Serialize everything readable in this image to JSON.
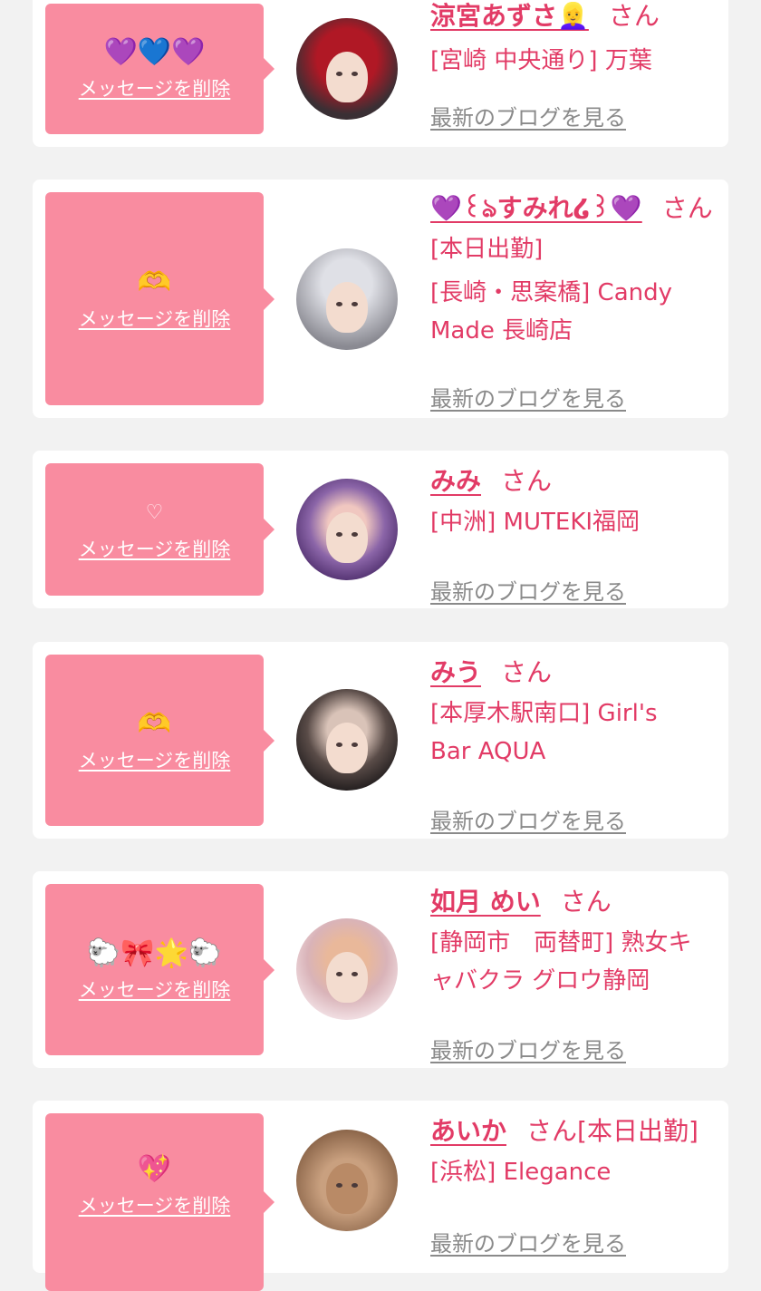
{
  "common": {
    "delete_label": "メッセージを削除",
    "blog_label": "最新のブログを見る",
    "san": "さん"
  },
  "items": [
    {
      "name": "涼宮あずさ👱‍♀️",
      "message": "💜💙💜",
      "suffix": "",
      "lines": [
        "[宮崎 中央通り] 万葉"
      ],
      "avatar_colors": [
        "#b01825",
        "#3a2f34"
      ]
    },
    {
      "name": "💜꒰ঌすみれ໒꒱💜",
      "message": "🫶",
      "suffix": "",
      "lines": [
        "[本日出勤]",
        "[長崎・思案橋] Candy",
        "Made 長崎店"
      ],
      "avatar_colors": [
        "#8a8a92",
        "#dfe0e6"
      ]
    },
    {
      "name": "みみ",
      "message": "♡",
      "suffix": "",
      "lines": [
        "[中洲] MUTEKI福岡"
      ],
      "avatar_colors": [
        "#4a2a68",
        "#8b65a8"
      ]
    },
    {
      "name": "みう",
      "message": "🫶",
      "suffix": "",
      "lines": [
        "[本厚木駅南口] Girl's",
        "Bar AQUA"
      ],
      "avatar_colors": [
        "#1e1a1b",
        "#5a4c48"
      ]
    },
    {
      "name": "如月 めい",
      "message": "🐑🎀🌟🐑",
      "suffix": "",
      "lines": [
        "[静岡市　両替町] 熟女キ",
        "ャバクラ グロウ静岡"
      ],
      "avatar_colors": [
        "#d9b3b8",
        "#f4e4e8"
      ]
    },
    {
      "name": "あいか",
      "message": "💖",
      "suffix": "[本日出勤]",
      "lines": [
        "[浜松] Elegance"
      ],
      "avatar_colors": [
        "#8a6448",
        "#c9a07f"
      ]
    }
  ]
}
